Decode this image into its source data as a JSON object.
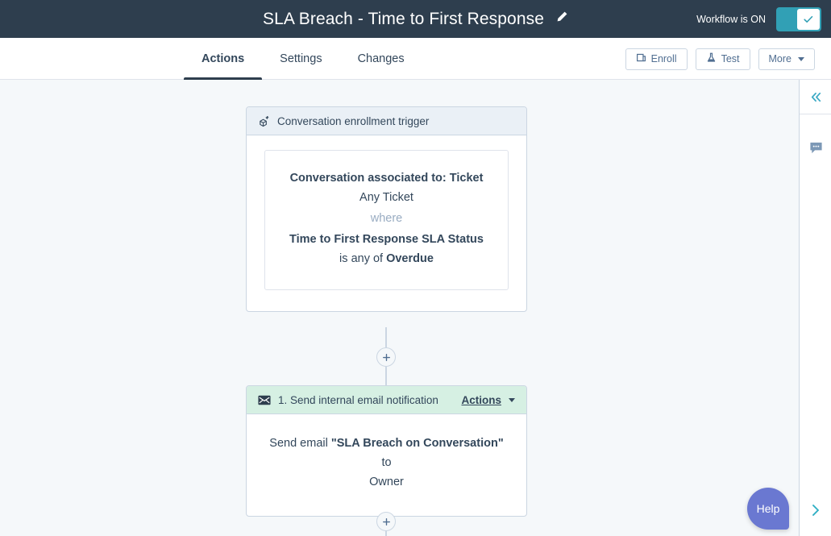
{
  "topbar": {
    "title": "SLA Breach - Time to First Response",
    "edit_icon": "pencil-icon",
    "status_label": "Workflow is ON",
    "toggle_state": "on",
    "toggle_color": "#31a0b5",
    "background_color": "#2e3e4e"
  },
  "navbar": {
    "tabs": [
      {
        "label": "Actions",
        "active": true
      },
      {
        "label": "Settings",
        "active": false
      },
      {
        "label": "Changes",
        "active": false
      }
    ],
    "buttons": [
      {
        "label": "Enroll",
        "icon": "enroll-icon"
      },
      {
        "label": "Test",
        "icon": "flask-icon"
      },
      {
        "label": "More",
        "icon": "chevron-down-icon"
      }
    ]
  },
  "flow": {
    "trigger": {
      "header_label": "Conversation enrollment trigger",
      "header_icon": "enrollment-trigger-icon",
      "criteria": {
        "line1_bold": "Conversation associated to: Ticket",
        "line2": "Any Ticket",
        "line3": "where",
        "line4_bold": "Time to First Response SLA Status",
        "line4_rest": " is",
        "line5_pre": "any of ",
        "line5_bold": "Overdue"
      }
    },
    "action": {
      "header_label": "1. Send internal email notification",
      "header_icon": "email-icon",
      "actions_menu_label": "Actions",
      "body_pre": "Send email ",
      "body_bold": "\"SLA Breach on Conversation\"",
      "body_post": " to",
      "body_line2": "Owner"
    },
    "add_step_label": "+"
  },
  "rail": {
    "collapse_icon": "chevrons-left-icon",
    "comments_icon": "comment-bubble-icon",
    "expand_icon": "chevron-right-icon"
  },
  "help": {
    "label": "Help",
    "color": "#6a78d1"
  }
}
